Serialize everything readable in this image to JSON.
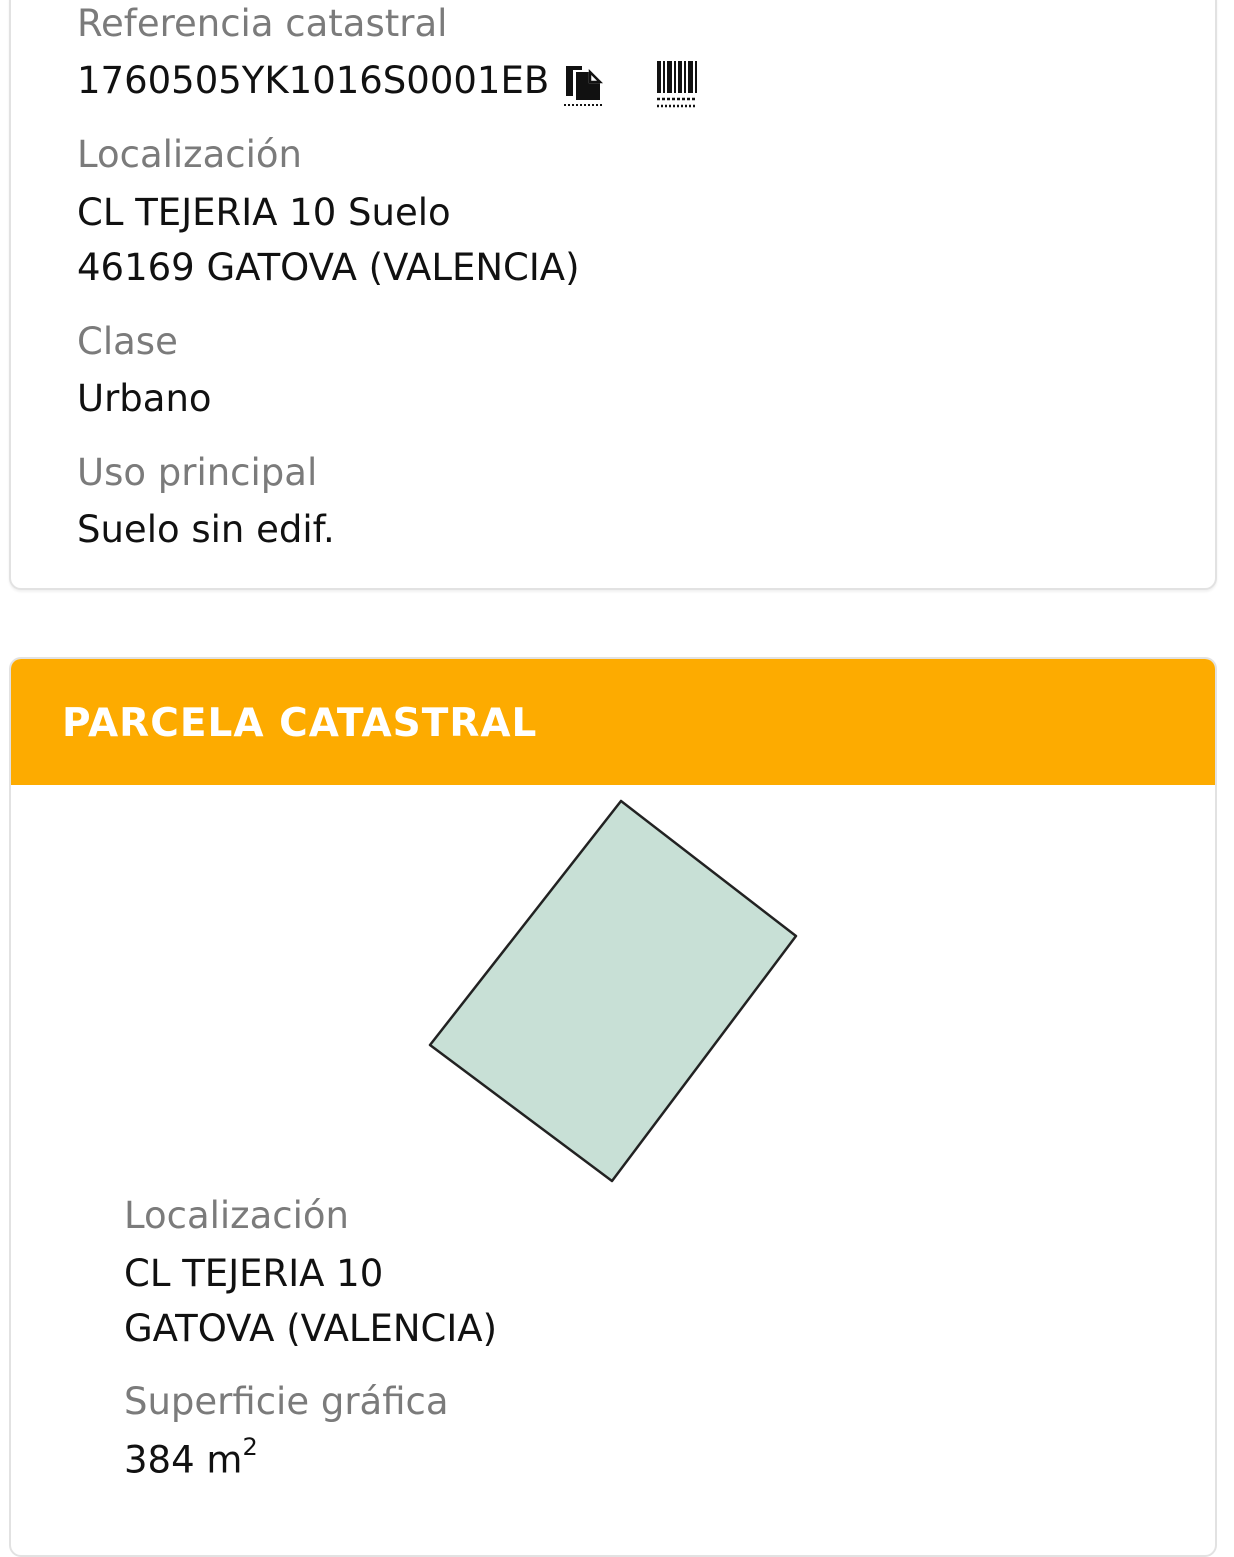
{
  "inmueble": {
    "ref_label": "Referencia catastral",
    "ref_value": "1760505YK1016S0001EB",
    "loc_label": "Localización",
    "loc_line1": "CL TEJERIA 10 Suelo",
    "loc_line2": "46169 GATOVA (VALENCIA)",
    "clase_label": "Clase",
    "clase_value": "Urbano",
    "uso_label": "Uso principal",
    "uso_value": "Suelo sin edif."
  },
  "parcela": {
    "title": "PARCELA CATASTRAL",
    "loc_label": "Localización",
    "loc_line1": "CL TEJERIA 10",
    "loc_line2": "GATOVA (VALENCIA)",
    "sup_label": "Superficie gráfica",
    "sup_value": "384",
    "sup_unit": "m",
    "sup_exp": "2"
  },
  "icons": {
    "copy": "copy-document-icon",
    "barcode": "barcode-icon"
  },
  "colors": {
    "header_bg": "#fdab00",
    "parcel_fill": "#c8e0d6",
    "label": "#7b7b7b",
    "value": "#111111"
  }
}
